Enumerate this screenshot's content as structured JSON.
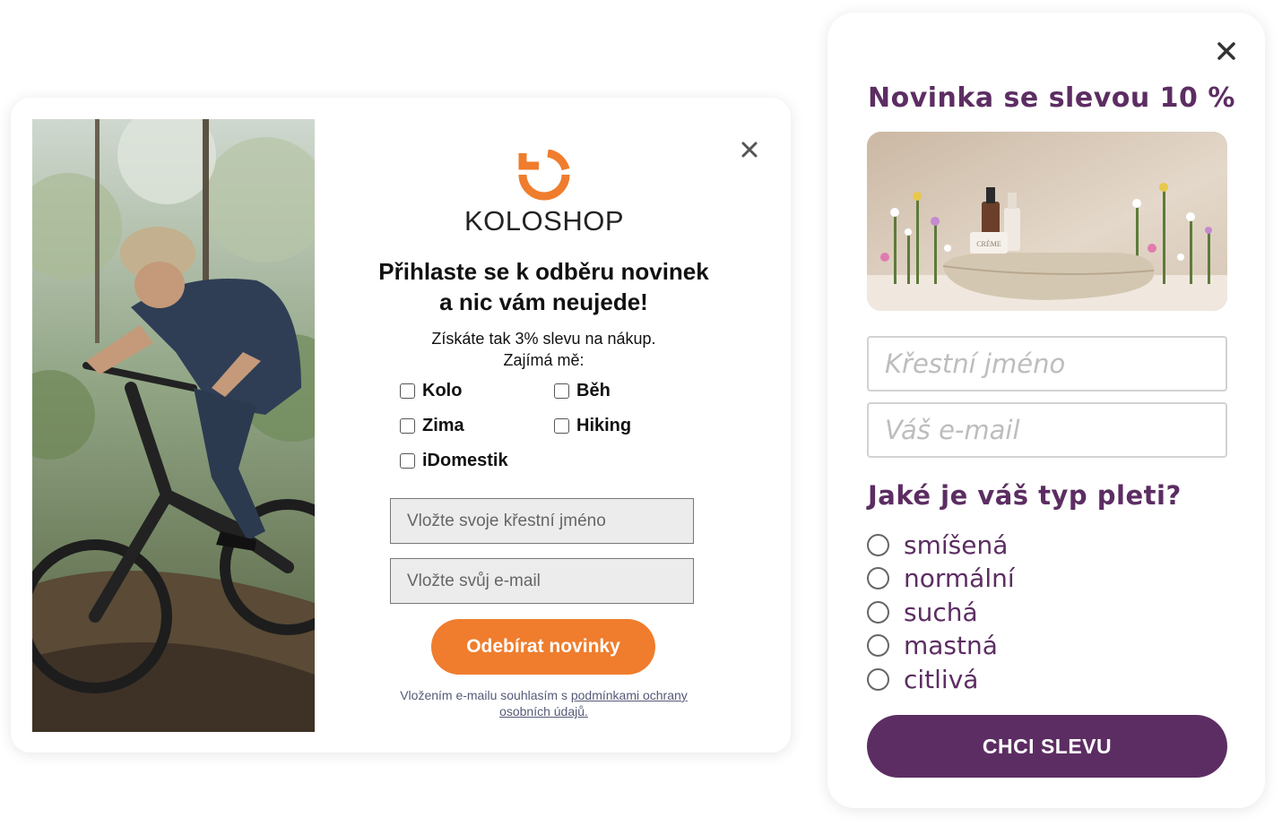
{
  "left_popup": {
    "brand": "KOLOSHOP",
    "headline_line1": "Přihlaste se k odběru novinek",
    "headline_line2": "a nic vám neujede!",
    "sub_line1": "Získáte tak 3% slevu na nákup.",
    "sub_line2": "Zajímá mě:",
    "interests": [
      {
        "label": "Kolo",
        "checked": false
      },
      {
        "label": "Běh",
        "checked": false
      },
      {
        "label": "Zima",
        "checked": false
      },
      {
        "label": "Hiking",
        "checked": false
      },
      {
        "label": "iDomestik",
        "checked": false
      }
    ],
    "first_name_placeholder": "Vložte svoje křestní jméno",
    "email_placeholder": "Vložte svůj e-mail",
    "submit_label": "Odebírat novinky",
    "consent_text": "Vložením e-mailu souhlasím s ",
    "consent_link_line1": "podmínkami ochrany",
    "consent_link_line2": "osobních údajů.",
    "accent_color": "#ef7d2d"
  },
  "right_popup": {
    "title": "Novinka se slevou 10 %",
    "product_label": "CRÈME",
    "first_name_placeholder": "Křestní jméno",
    "email_placeholder": "Váš e-mail",
    "question": "Jaké je váš typ pleti?",
    "skin_types": [
      {
        "label": "smíšená",
        "selected": false
      },
      {
        "label": "normální",
        "selected": false
      },
      {
        "label": "suchá",
        "selected": false
      },
      {
        "label": "mastná",
        "selected": false
      },
      {
        "label": "citlivá",
        "selected": false
      }
    ],
    "submit_label": "CHCI SLEVU",
    "accent_color": "#5c2d62"
  }
}
